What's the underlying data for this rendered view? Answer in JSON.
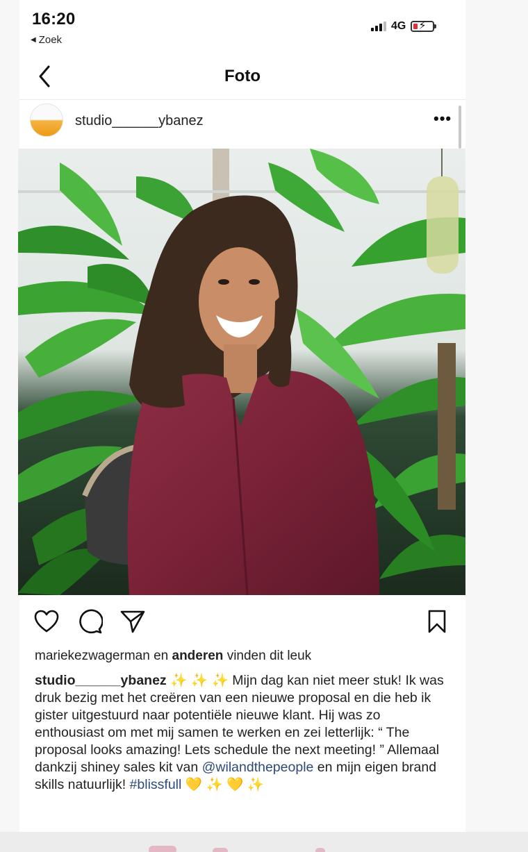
{
  "status_bar": {
    "time": "16:20",
    "back_app_label": "Zoek",
    "network": "4G"
  },
  "nav": {
    "title": "Foto"
  },
  "post": {
    "username": "studio______ybanez",
    "more_icon": "more-horizontal-icon",
    "likes": {
      "liker": "mariekezwagerman",
      "connector": " en ",
      "others": "anderen",
      "suffix": " vinden dit leuk"
    },
    "caption": {
      "author": "studio______ybanez",
      "sparkles": " ✨ ✨ ✨ ",
      "text_part1": "Mijn dag kan niet meer stuk! Ik was druk bezig met het creëren van een nieuwe proposal en die heb ik gister uitgestuurd naar potentiële nieuwe klant. Hij was zo enthousiast om met mij samen te werken en zei letterlijk: “ The proposal looks amazing! Lets schedule the next meeting! ” Allemaal dankzij shiney sales kit van ",
      "mention": "@wilandthepeople",
      "text_part2": " en mijn eigen brand skills natuurlijk! ",
      "hashtag": "#blissfull",
      "emoji_tail_1": " 💛",
      "emoji_tail_2": " ✨",
      "emoji_tail_3": " 💛",
      "emoji_tail_4": " ✨"
    },
    "actions": {
      "like_icon": "heart-icon",
      "comment_icon": "comment-icon",
      "share_icon": "send-icon",
      "save_icon": "bookmark-icon"
    }
  },
  "colors": {
    "text": "#111111",
    "mention": "#2c4b78",
    "battery_low": "#e0303a",
    "avatar_orange": "#ee9a15"
  }
}
